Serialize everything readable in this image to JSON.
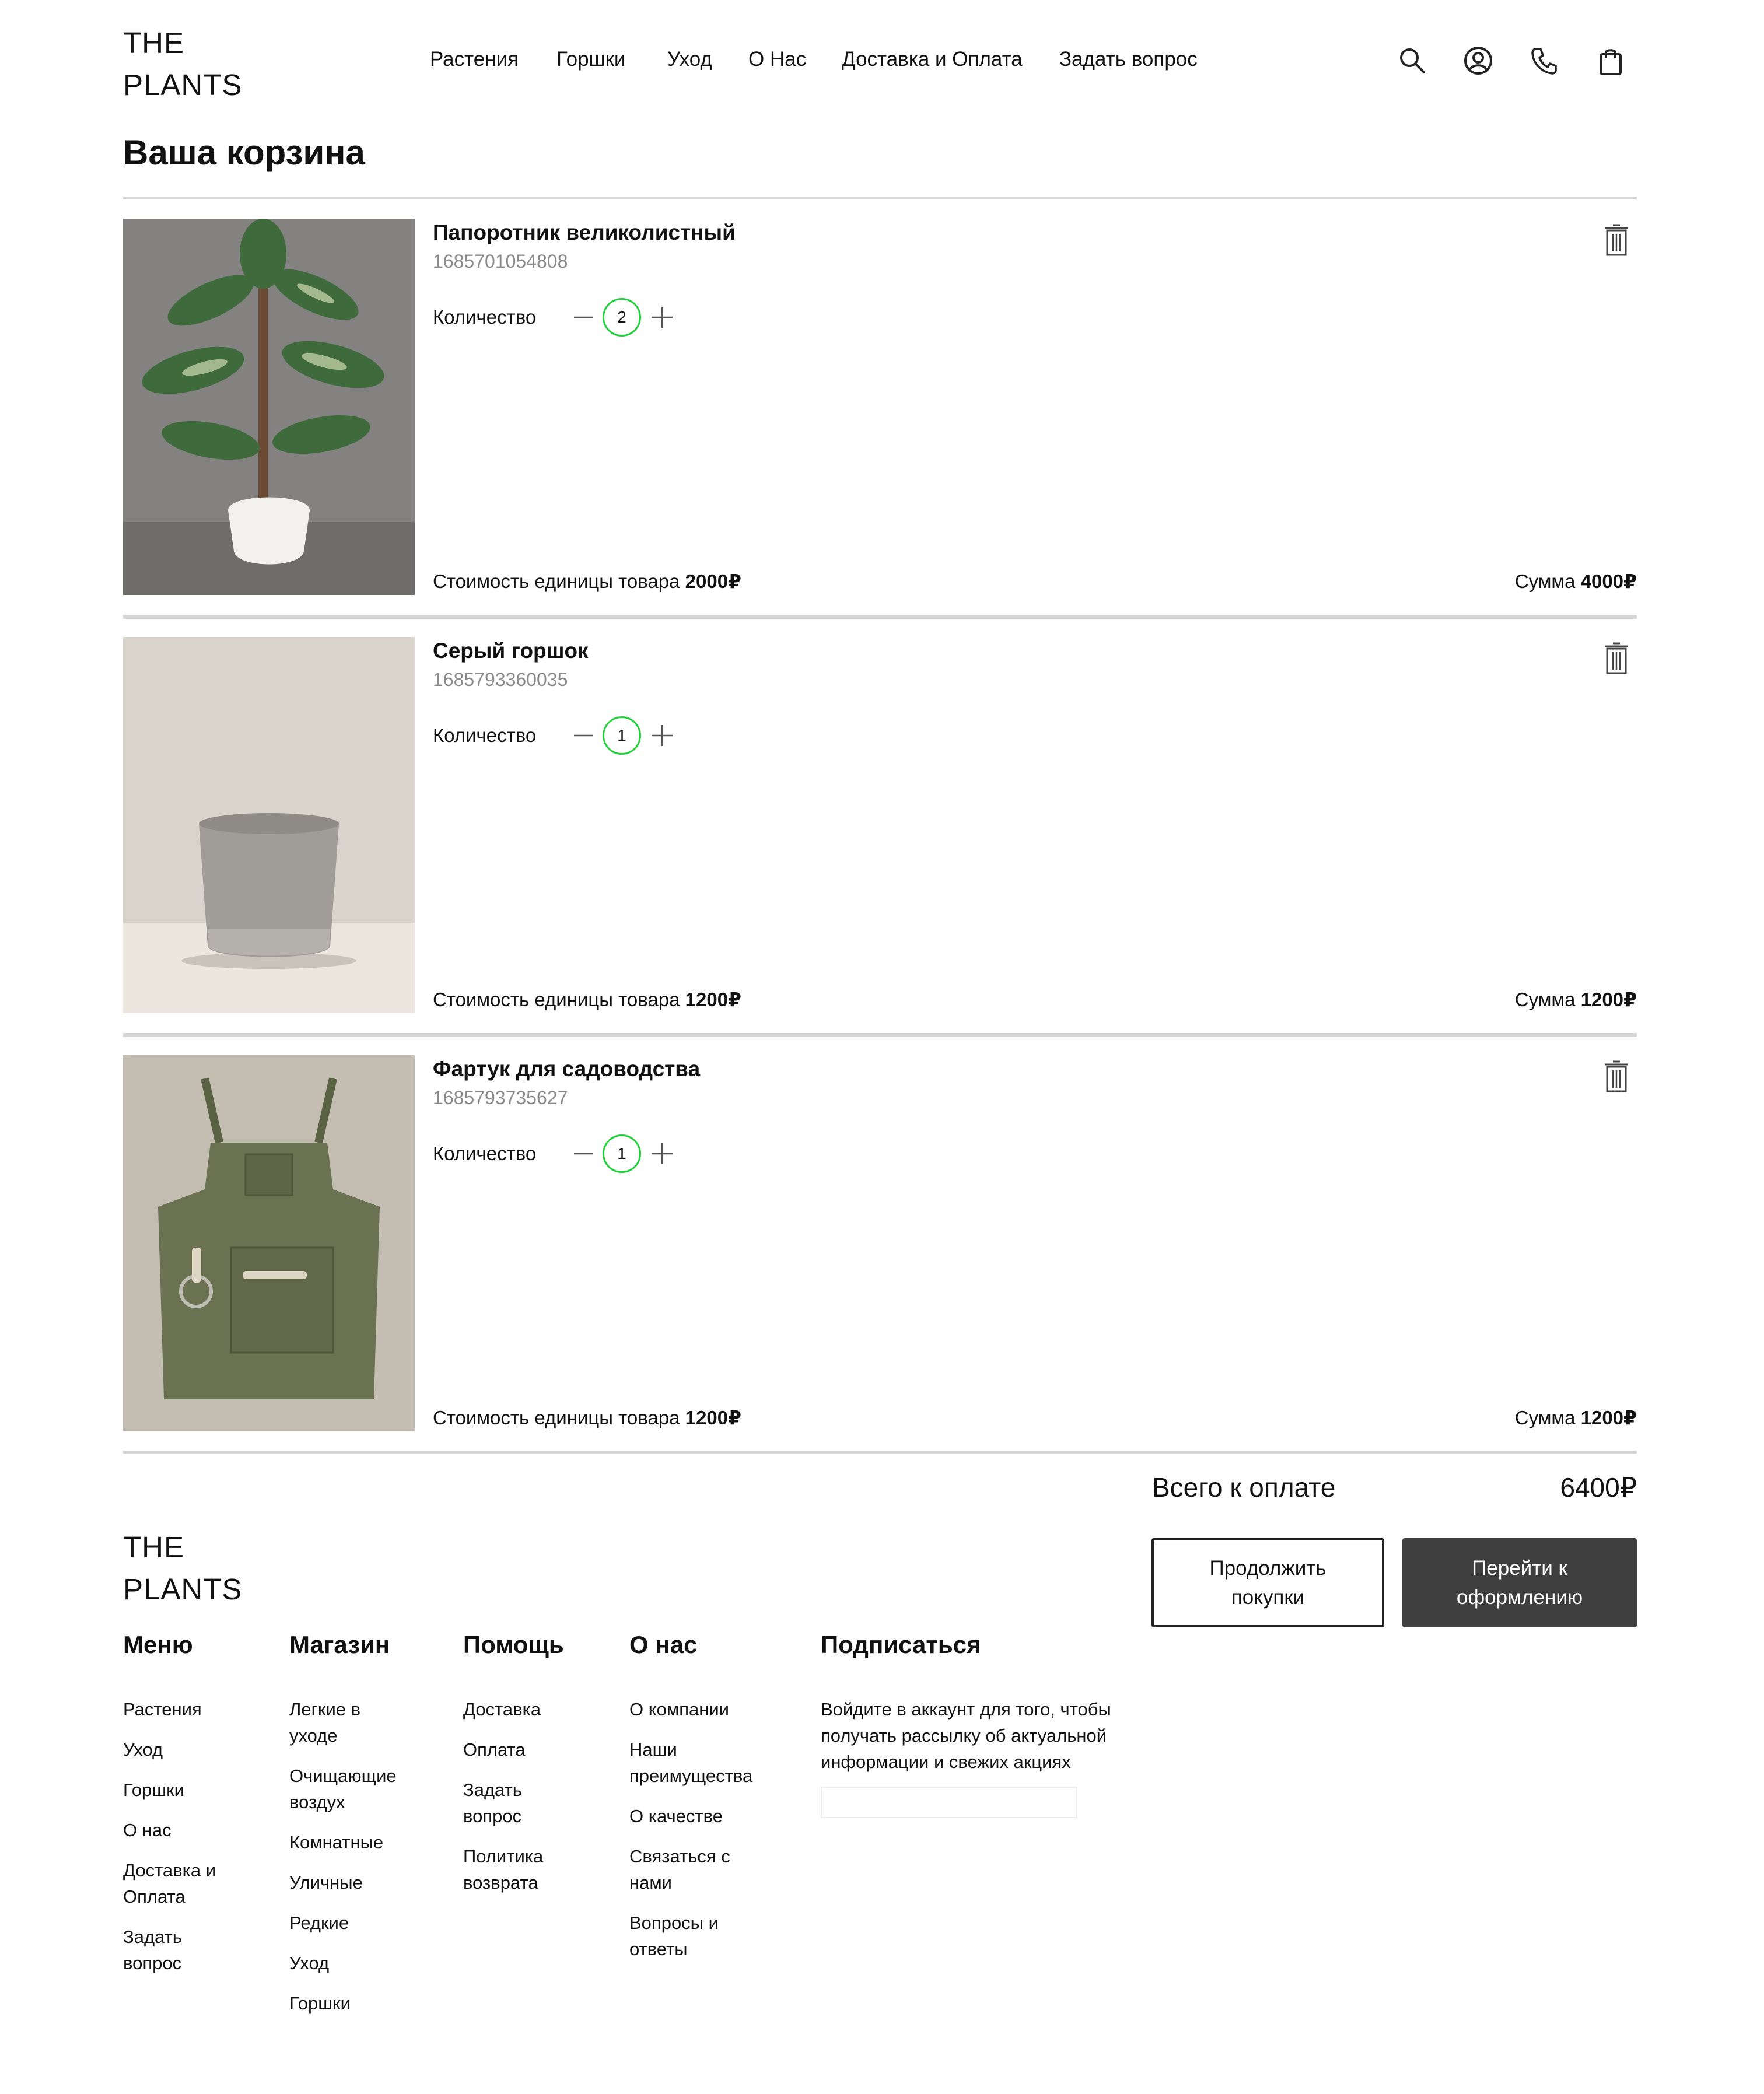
{
  "brand": {
    "line1": "THE",
    "line2": "PLANTS"
  },
  "nav": [
    "Растения",
    "Горшки",
    "Уход",
    "О Нас",
    "Доставка и Оплата",
    "Задать вопрос"
  ],
  "header_icons": [
    "search-icon",
    "user-icon",
    "phone-icon",
    "bag-icon"
  ],
  "page": {
    "title": "Ваша корзина"
  },
  "cart": {
    "quantity_label": "Количество",
    "unit_price_label": "Стоимость единицы товара",
    "sum_label": "Сумма",
    "items": [
      {
        "name": "Папоротник великолистный",
        "sku": "1685701054808",
        "qty": "2",
        "unit_price": "2000₽",
        "sum": "4000₽"
      },
      {
        "name": "Серый горшок",
        "sku": "1685793360035",
        "qty": "1",
        "unit_price": "1200₽",
        "sum": "1200₽"
      },
      {
        "name": "Фартук для садоводства",
        "sku": "1685793735627",
        "qty": "1",
        "unit_price": "1200₽",
        "sum": "1200₽"
      }
    ]
  },
  "summary": {
    "total_label": "Всего к оплате",
    "total_value": "6400₽",
    "continue_button": "Продолжить покупки",
    "checkout_button": "Перейти к оформлению"
  },
  "footer": {
    "brand": {
      "line1": "THE",
      "line2": "PLANTS"
    },
    "columns": [
      {
        "title": "Меню",
        "links": [
          "Растения",
          "Уход",
          "Горшки",
          "О нас",
          "Доставка и Оплата",
          "Задать вопрос"
        ]
      },
      {
        "title": "Магазин",
        "links": [
          "Легкие в уходе",
          "Очищающие воздух",
          "Комнатные",
          "Уличные",
          "Редкие",
          "Уход",
          "Горшки"
        ]
      },
      {
        "title": "Помощь",
        "links": [
          "Доставка",
          "Оплата",
          "Задать вопрос",
          "Политика возврата"
        ]
      },
      {
        "title": "О нас",
        "links": [
          "О компании",
          "Наши преимущества",
          "О качестве",
          "Связаться с нами",
          "Вопросы и ответы"
        ]
      }
    ],
    "subscribe": {
      "title": "Подписаться",
      "text": "Войдите в аккаунт для того, чтобы получать рассылку об актуальной информации и свежих акциях",
      "input_value": ""
    }
  },
  "colors": {
    "accent_green": "#22d03c",
    "dark_button": "#3f3f3f",
    "divider": "#d6d6d6"
  }
}
